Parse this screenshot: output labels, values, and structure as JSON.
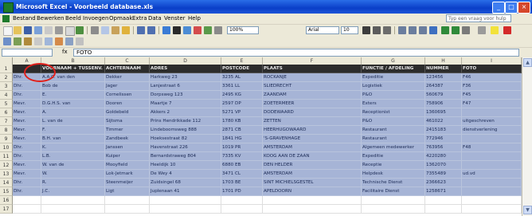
{
  "titlebar": {
    "title": "Microsoft Excel - Voorbeeld database.xls",
    "minimize": "_",
    "maximize": "□",
    "close": "×"
  },
  "menu": {
    "items": [
      "Bestand",
      "Bewerken",
      "Beeld",
      "Invoegen",
      "Opmaak",
      "Extra",
      "Data",
      "Venster",
      "Help"
    ],
    "help_placeholder": "Typ een vraag voor hulp"
  },
  "toolbar": {
    "font": "Arial",
    "size": "10",
    "zoom": "100%"
  },
  "formula_bar": {
    "name_box": "",
    "fx": "fx",
    "content": "FOTO"
  },
  "columns": [
    "A",
    "B",
    "C",
    "D",
    "E",
    "F",
    "G",
    "H",
    "I"
  ],
  "header_row": [
    "",
    "VOORNAAM + TUSSENV.",
    "ACHTERNAAM",
    "ADRES",
    "POSTCODE",
    "PLAATS",
    "FUNCTIE / AFDELING",
    "NUMMER",
    "FOTO"
  ],
  "rows": [
    [
      "Dhr.",
      "A.A.C. van den",
      "Dekker",
      "Harkweg 23",
      "3235 AL",
      "ROCKANJE",
      "Expeditie",
      "123456",
      "F46"
    ],
    [
      "Dhr.",
      "Bob de",
      "Jager",
      "Lanjestraat 6",
      "3361 LL",
      "SLIEDRECHT",
      "Logistiek",
      "264387",
      "F36"
    ],
    [
      "Dhr.",
      "E.",
      "Cornelissen",
      "Dorpsweg 123",
      "2495 KG",
      "ZAANDAM",
      "P&O",
      "560679",
      "F45"
    ],
    [
      "Mevr.",
      "D.G.H.S. van",
      "Dooren",
      "Maartje 7",
      "2597 DP",
      "ZOETERMEER",
      "Exters",
      "758906",
      "F47"
    ],
    [
      "Mevr.",
      "A.",
      "Goldebeld",
      "Akkers 2",
      "5271 VP",
      "DODEWAARD",
      "Receptionist",
      "1360695",
      ""
    ],
    [
      "Mevr.",
      "L. van de",
      "Sijtsma",
      "Prins Hendrikkade 112",
      "1780 KB",
      "ZETTEN",
      "P&O",
      "461022",
      "uitgeschreven"
    ],
    [
      "Mevr.",
      "F.",
      "Timmer",
      "Lindeboomsweg 888",
      "2871 CB",
      "HEERHUGOWAARD",
      "Restaurant",
      "2415183",
      "dienstverlening"
    ],
    [
      "Mevr.",
      "B.H. van",
      "Zandbeek",
      "Hoeksestraat 82",
      "1841 HG",
      "'S-GRAVENHAGE",
      "Restaurant",
      "772946",
      ""
    ],
    [
      "Dhr.",
      "K.",
      "Janssen",
      "Havenstraat 226",
      "1019 PR",
      "AMSTERDAM",
      "Algemeen medewerker",
      "763956",
      "F48"
    ],
    [
      "Dhr.",
      "L.B.",
      "Kuiper",
      "Bernardstraweg 804",
      "7335 KV",
      "KOOG AAN DE ZAAN",
      "Expeditie",
      "4220280",
      ""
    ],
    [
      "Mevr.",
      "W. van de",
      "Mooyfield",
      "Heeldijk 10",
      "6880 EB",
      "DEN HELDER",
      "Receptie",
      "1362070",
      ""
    ],
    [
      "Mevr.",
      "W.",
      "Lok-Jetmark",
      "De Wey 4",
      "3471 CL",
      "AMSTERDAM",
      "Helpdesk",
      "7355489",
      "ud.vd"
    ],
    [
      "Dhr.",
      "R.",
      "Steenmeijer",
      "Zuidsingel 68",
      "1703 BE",
      "SINT MICHIELSGESTEL",
      "Technische Dienst",
      "2366623",
      ""
    ],
    [
      "Dhr.",
      "J.C.",
      "Ligt",
      "Juplenaan 41",
      "1701 PD",
      "APELDOORN",
      "Facilitaire Dienst",
      "1258671",
      ""
    ]
  ],
  "blank_rows": [
    "16",
    "17"
  ]
}
